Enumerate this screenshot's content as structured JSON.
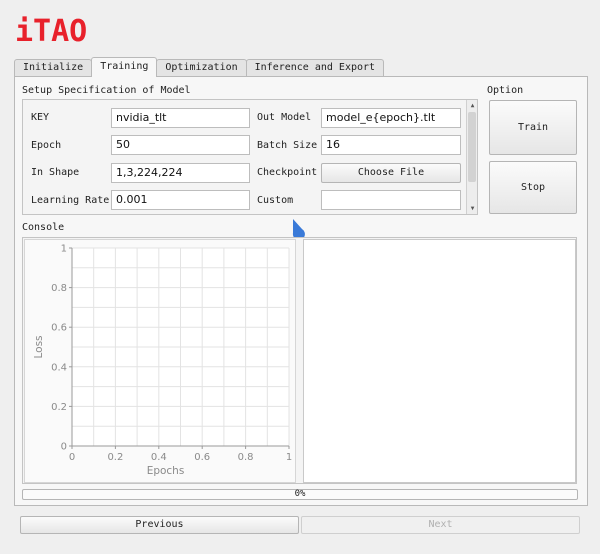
{
  "app": {
    "logo": "iTAO"
  },
  "tabs": [
    {
      "label": "Initialize",
      "active": false
    },
    {
      "label": "Training",
      "active": true
    },
    {
      "label": "Optimization",
      "active": false
    },
    {
      "label": "Inference and Export",
      "active": false
    }
  ],
  "setup": {
    "title": "Setup Specification of Model",
    "key_label": "KEY",
    "key_value": "nvidia_tlt",
    "epoch_label": "Epoch",
    "epoch_value": "50",
    "shape_label": "In Shape",
    "shape_value": "1,3,224,224",
    "lr_label": "Learning Rate",
    "lr_value": "0.001",
    "out_model_label": "Out Model",
    "out_model_value": "model_e{epoch}.tlt",
    "batch_label": "Batch Size",
    "batch_value": "16",
    "checkpoint_label": "Checkpoint",
    "checkpoint_button": "Choose File",
    "custom_label": "Custom",
    "custom_value": ""
  },
  "option": {
    "title": "Option",
    "train_label": "Train",
    "stop_label": "Stop"
  },
  "console": {
    "title": "Console",
    "log_text": ""
  },
  "chart_data": {
    "type": "line",
    "title": "",
    "xlabel": "Epochs",
    "ylabel": "Loss",
    "xlim": [
      0,
      1
    ],
    "ylim": [
      0,
      1
    ],
    "xticks": [
      "0",
      "0.2",
      "0.4",
      "0.6",
      "0.8",
      "1"
    ],
    "yticks": [
      "0",
      "0.2",
      "0.4",
      "0.6",
      "0.8",
      "1"
    ],
    "grid": true,
    "series": []
  },
  "progress": {
    "value": 0,
    "label": "0%"
  },
  "nav": {
    "previous_label": "Previous",
    "next_label": "Next"
  }
}
